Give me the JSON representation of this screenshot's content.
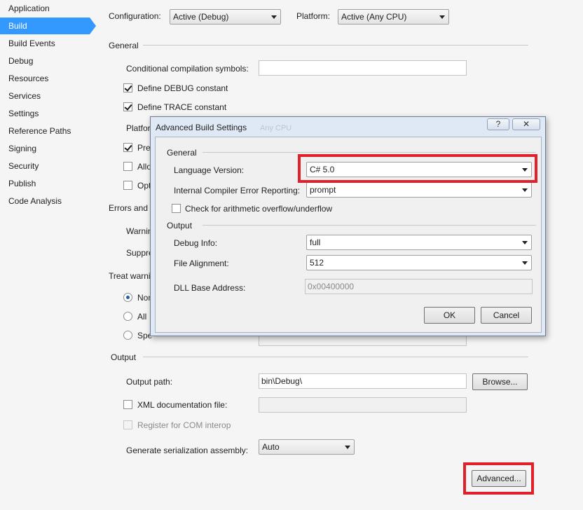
{
  "sidebar": {
    "items": [
      "Application",
      "Build",
      "Build Events",
      "Debug",
      "Resources",
      "Services",
      "Settings",
      "Reference Paths",
      "Signing",
      "Security",
      "Publish",
      "Code Analysis"
    ],
    "active": "Build"
  },
  "top": {
    "configuration_label": "Configuration:",
    "configuration_value": "Active (Debug)",
    "platform_label": "Platform:",
    "platform_value": "Active (Any CPU)"
  },
  "general": {
    "header": "General",
    "cond_symbols_label": "Conditional compilation symbols:",
    "cond_symbols_value": "",
    "define_debug": "Define DEBUG constant",
    "define_debug_checked": true,
    "define_trace": "Define TRACE constant",
    "define_trace_checked": true,
    "platform_target_partial": "Platfor",
    "platform_target_value": "Any CPU",
    "prefer_partial": "Pre",
    "prefer_checked": true,
    "allow_partial": "Allo",
    "allow_checked": false,
    "optimize_partial": "Opt",
    "optimize_checked": false
  },
  "errors": {
    "header_partial": "Errors and w",
    "warning_partial": "Warnin",
    "suppress_partial": "Suppre"
  },
  "treat": {
    "header_partial": "Treat warni",
    "none_partial": "Non",
    "all_partial": "All",
    "specific_partial": "Spe"
  },
  "output": {
    "header": "Output",
    "path_label": "Output path:",
    "path_value": "bin\\Debug\\",
    "browse_label": "Browse...",
    "xml_doc_label": "XML documentation file:",
    "xml_doc_checked": false,
    "register_com_label": "Register for COM interop",
    "register_com_checked": false,
    "serialization_label": "Generate serialization assembly:",
    "serialization_value": "Auto",
    "advanced_label": "Advanced..."
  },
  "dialog": {
    "title": "Advanced Build Settings",
    "help_glyph": "?",
    "close_glyph": "✕",
    "general_header": "General",
    "language_label": "Language Version:",
    "language_value": "C# 5.0",
    "ice_label": "Internal Compiler Error Reporting:",
    "ice_value": "prompt",
    "overflow_label": "Check for arithmetic overflow/underflow",
    "overflow_checked": false,
    "output_header": "Output",
    "debug_info_label": "Debug Info:",
    "debug_info_value": "full",
    "file_align_label": "File Alignment:",
    "file_align_value": "512",
    "dll_base_label": "DLL Base Address:",
    "dll_base_value": "0x00400000",
    "ok_label": "OK",
    "cancel_label": "Cancel"
  },
  "colors": {
    "accent": "#3399ff",
    "highlight": "#e0202a"
  }
}
